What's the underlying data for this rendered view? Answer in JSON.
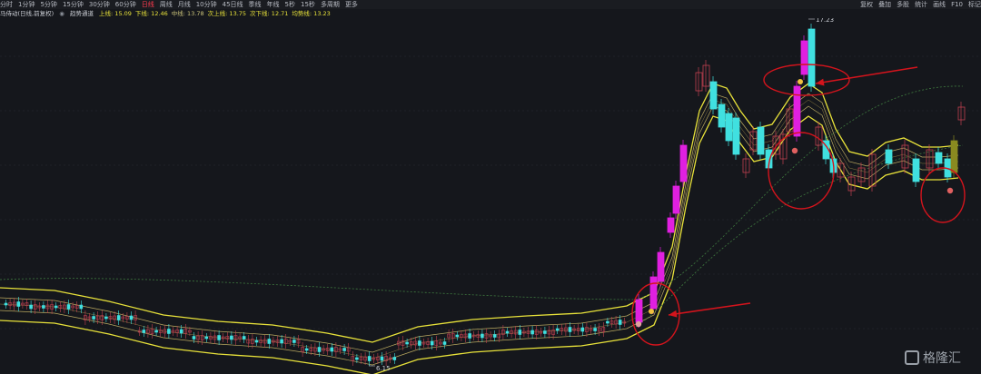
{
  "toolbar": {
    "periods": [
      "分时",
      "1分钟",
      "5分钟",
      "15分钟",
      "30分钟",
      "60分钟",
      "日线",
      "周线",
      "月线",
      "10分钟",
      "45日线",
      "季线",
      "年线",
      "5秒",
      "15秒",
      "多周期",
      "更多"
    ],
    "active": "日线",
    "right": [
      "复权",
      "叠加",
      "多股",
      "统计",
      "画线",
      "F10",
      "标记"
    ]
  },
  "legend": {
    "title": "马侍动(日线,前复权)",
    "indicator": "趋势通道",
    "items": [
      {
        "label": "上线: 15.09",
        "color": "#e8e23a"
      },
      {
        "label": "下线: 12.46",
        "color": "#e8e23a"
      },
      {
        "label": "中线: 13.78",
        "color": "#c9c27a"
      },
      {
        "label": "次上线: 13.75",
        "color": "#e8e23a"
      },
      {
        "label": "次下线: 12.71",
        "color": "#e8e23a"
      },
      {
        "label": "均势线: 13.23",
        "color": "#e8e23a"
      }
    ]
  },
  "annotations": {
    "high": "17.23",
    "low": "6.15"
  },
  "watermark": "格隆汇",
  "colors": {
    "up": "#e020e0",
    "down": "#40e0e0",
    "band": "#e8e23a",
    "mid": "#b9a860",
    "circle": "#d4141c",
    "bg": "#15171c"
  }
}
